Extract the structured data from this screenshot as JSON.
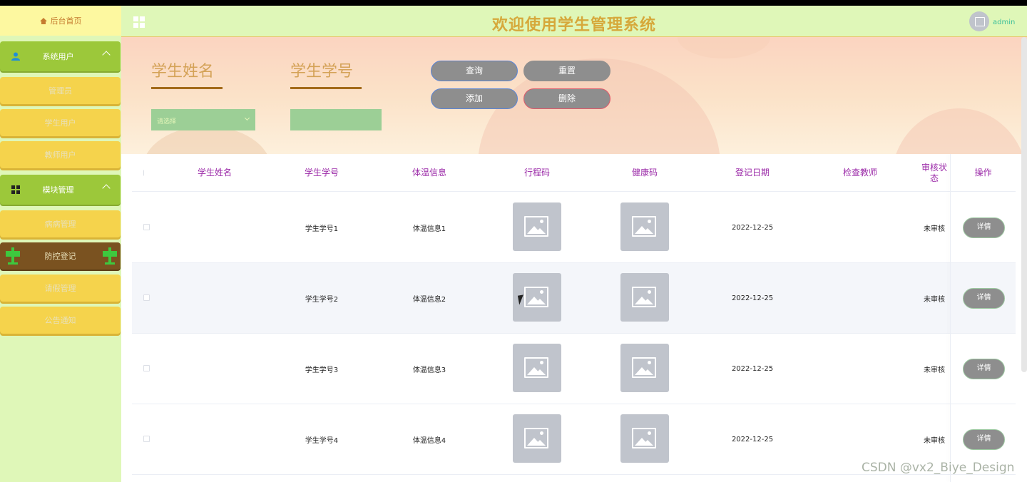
{
  "header": {
    "title": "欢迎使用学生管理系统",
    "username": "admin"
  },
  "sidebar": {
    "home": "后台首页",
    "groups": [
      {
        "label": "系统用户",
        "items": [
          "管理员",
          "学生用户",
          "教师用户"
        ]
      },
      {
        "label": "模块管理",
        "items": [
          "病病管理",
          "防控登记",
          "请假管理",
          "公告通知"
        ]
      }
    ],
    "active_item": "防控登记"
  },
  "search": {
    "student_name_label": "学生姓名",
    "student_id_label": "学生学号",
    "select_placeholder": "请选择",
    "student_id_value": "",
    "buttons": {
      "query": "查询",
      "reset": "重置",
      "add": "添加",
      "delete": "删除"
    }
  },
  "table": {
    "columns": [
      "学生姓名",
      "学生学号",
      "体温信息",
      "行程码",
      "健康码",
      "登记日期",
      "检查教师",
      "审核状态",
      "操作"
    ],
    "rows": [
      {
        "name": "",
        "id": "学生学号1",
        "temp": "体温信息1",
        "date": "2022-12-25",
        "teacher": "",
        "status": "未审核",
        "action": "详情"
      },
      {
        "name": "",
        "id": "学生学号2",
        "temp": "体温信息2",
        "date": "2022-12-25",
        "teacher": "",
        "status": "未审核",
        "action": "详情"
      },
      {
        "name": "",
        "id": "学生学号3",
        "temp": "体温信息3",
        "date": "2022-12-25",
        "teacher": "",
        "status": "未审核",
        "action": "详情"
      },
      {
        "name": "",
        "id": "学生学号4",
        "temp": "体温信息4",
        "date": "2022-12-25",
        "teacher": "",
        "status": "未审核",
        "action": "详情"
      }
    ]
  },
  "watermark": "CSDN @vx2_Biye_Design",
  "colors": {
    "sidebar_group": "#9cc83a",
    "sidebar_item": "#f5d34c",
    "sidebar_active": "#7a5220",
    "header_bg": "#dff7b8",
    "title": "#d6a83a",
    "column_header": "#9b2aa8",
    "button": "#8e8e8e"
  },
  "icons": {
    "home": "home-icon",
    "user": "user-icon",
    "grid": "grid-icon",
    "active_item": "signpost-icon",
    "thumbnail": "image-placeholder-icon"
  }
}
